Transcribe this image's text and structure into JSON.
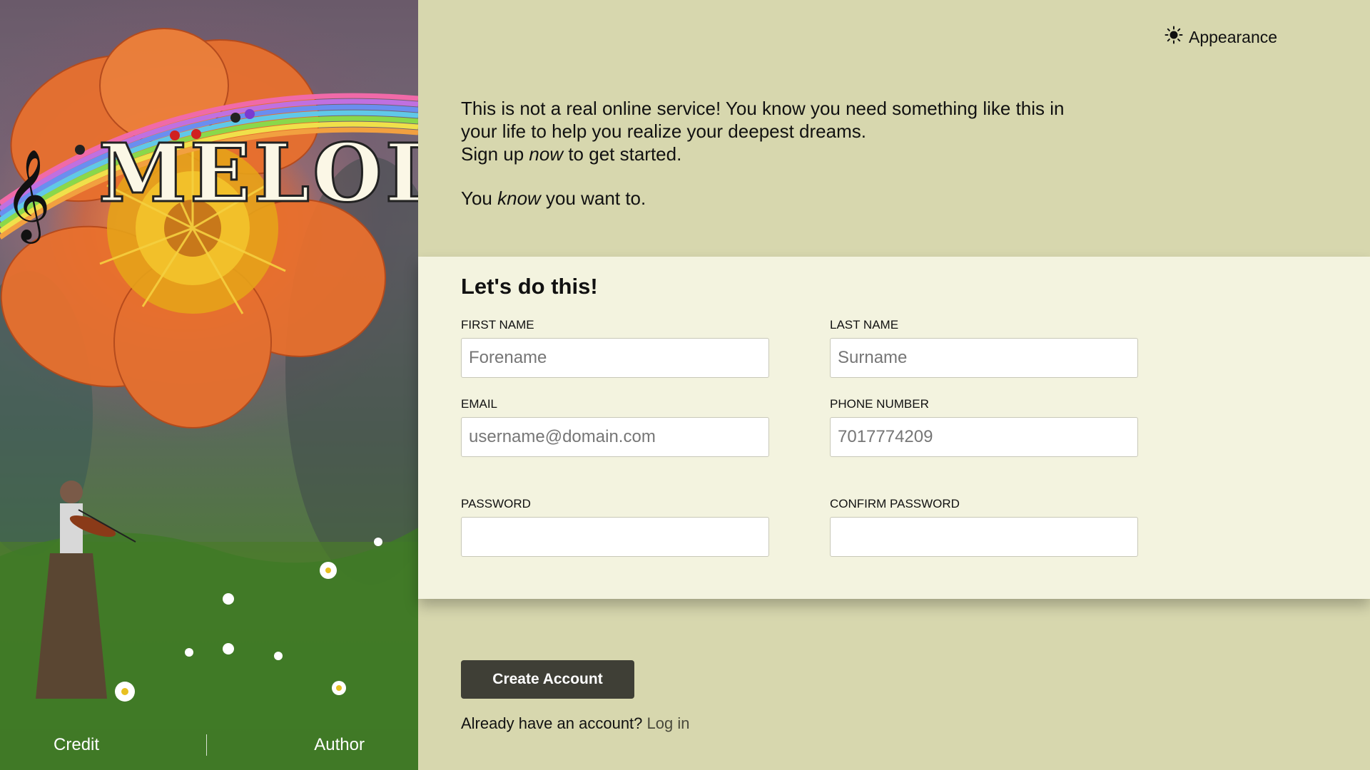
{
  "brand": {
    "logo_text": "MELODY"
  },
  "art_footer": {
    "credit_label": "Credit",
    "author_label": "Author"
  },
  "appearance": {
    "label": "Appearance",
    "icon": "sun-icon"
  },
  "intro": {
    "line1": "This is not a real online service! You know you need something like this in your life to help you realize your deepest dreams.",
    "signup_pre": "Sign up ",
    "signup_em": "now",
    "signup_post": " to get started.",
    "know_pre": "You ",
    "know_em": "know",
    "know_post": " you want to."
  },
  "form": {
    "heading": "Let's do this!",
    "first_name": {
      "label": "First name",
      "placeholder": "Forename",
      "value": ""
    },
    "last_name": {
      "label": "Last name",
      "placeholder": "Surname",
      "value": ""
    },
    "email": {
      "label": "Email",
      "placeholder": "username@domain.com",
      "value": ""
    },
    "phone": {
      "label": "Phone number",
      "placeholder": "7017774209",
      "value": ""
    },
    "password": {
      "label": "Password",
      "placeholder": "",
      "value": ""
    },
    "confirm_password": {
      "label": "Confirm password",
      "placeholder": "",
      "value": ""
    }
  },
  "actions": {
    "create_label": "Create Account",
    "login_prompt": "Already have an account?",
    "login_link": "Log in"
  },
  "colors": {
    "page_bg": "#d7d7ae",
    "card_bg": "#f3f3df",
    "button_bg": "#3f3f36"
  }
}
